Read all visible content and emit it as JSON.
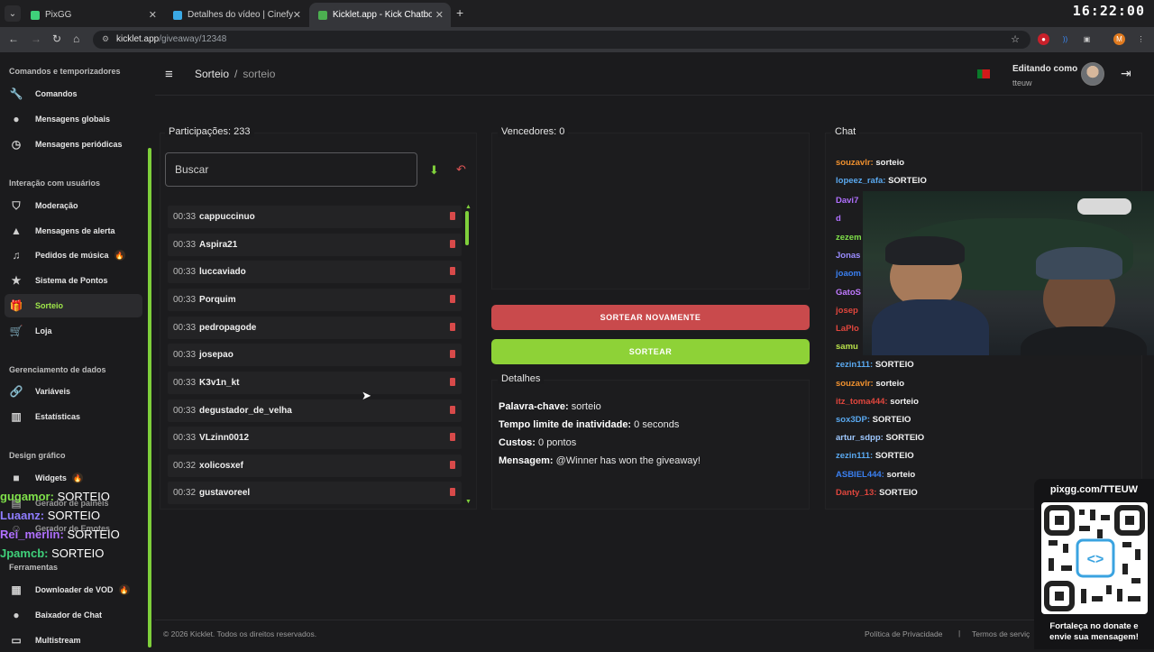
{
  "browser": {
    "clock": "16:22:00",
    "tabs": [
      {
        "label": "PixGG",
        "color": "#3fd17a"
      },
      {
        "label": "Detalhes do vídeo | Cinefy",
        "color": "#3aa9e6"
      },
      {
        "label": "Kicklet.app - Kick Chatbot and",
        "color": "#4caf50"
      }
    ],
    "url_host": "kicklet.app",
    "url_path": "/giveaway/12348"
  },
  "sidebar": {
    "sections": [
      {
        "title": "Comandos e temporizadores",
        "items": [
          "Comandos",
          "Mensagens globais",
          "Mensagens periódicas"
        ]
      },
      {
        "title": "Interação com usuários",
        "items": [
          "Moderação",
          "Mensagens de alerta",
          "Pedidos de música",
          "Sistema de Pontos",
          "Sorteio",
          "Loja"
        ]
      },
      {
        "title": "Gerenciamento de dados",
        "items": [
          "Variáveis",
          "Estatísticas"
        ]
      },
      {
        "title": "Design gráfico",
        "items": [
          "Widgets",
          "Gerador de painéis",
          "Gerador de Emotes"
        ]
      },
      {
        "title": "Ferramentas",
        "items": [
          "Downloader de VOD",
          "Baixador de Chat",
          "Multistream"
        ]
      }
    ]
  },
  "header": {
    "breadcrumb_root": "Sorteio",
    "breadcrumb_current": "sorteio",
    "editing_as": "Editando como",
    "username": "tteuw"
  },
  "participants": {
    "title": "Participações: 233",
    "search_placeholder": "Buscar",
    "entries": [
      {
        "time": "00:33",
        "name": "cappuccinuo"
      },
      {
        "time": "00:33",
        "name": "Aspira21"
      },
      {
        "time": "00:33",
        "name": "luccaviado"
      },
      {
        "time": "00:33",
        "name": "Porquim"
      },
      {
        "time": "00:33",
        "name": "pedropagode"
      },
      {
        "time": "00:33",
        "name": "josepao"
      },
      {
        "time": "00:33",
        "name": "K3v1n_kt"
      },
      {
        "time": "00:33",
        "name": "degustador_de_velha"
      },
      {
        "time": "00:33",
        "name": "VLzinn0012"
      },
      {
        "time": "00:32",
        "name": "xolicosxef"
      },
      {
        "time": "00:32",
        "name": "gustavoreel"
      }
    ]
  },
  "winners": {
    "title": "Vencedores: 0"
  },
  "buttons": {
    "redraw": "SORTEAR NOVAMENTE",
    "draw": "SORTEAR"
  },
  "details": {
    "title": "Detalhes",
    "keyword_label": "Palavra-chave:",
    "keyword_value": "sorteio",
    "inactivity_label": "Tempo limite de inatividade:",
    "inactivity_value": "0 seconds",
    "cost_label": "Custos:",
    "cost_value": "0 pontos",
    "message_label": "Mensagem:",
    "message_value": "@Winner has won the giveaway!"
  },
  "chat": {
    "title": "Chat",
    "lines": [
      {
        "user": "souzavlr:",
        "msg": "sorteio",
        "color": "#f0912f"
      },
      {
        "user": "lopeez_rafa:",
        "msg": "SORTEIO",
        "color": "#5aa9f0"
      },
      {
        "user": "Davi7",
        "msg": "",
        "color": "#b070ff"
      },
      {
        "user": "d",
        "msg": "",
        "color": "#b070ff"
      },
      {
        "user": "zezem",
        "msg": "",
        "color": "#7fe04a"
      },
      {
        "user": "Jonas",
        "msg": "",
        "color": "#9a8cff"
      },
      {
        "user": "joaom",
        "msg": "",
        "color": "#3a7ff0"
      },
      {
        "user": "GatoS",
        "msg": "",
        "color": "#c07aff"
      },
      {
        "user": "josep",
        "msg": "",
        "color": "#e0463d"
      },
      {
        "user": "LaPlo",
        "msg": "",
        "color": "#e0463d"
      },
      {
        "user": "samu",
        "msg": "",
        "color": "#b8e04a"
      },
      {
        "user": "zezin111:",
        "msg": "SORTEIO",
        "color": "#5aa9f0"
      },
      {
        "user": "souzavlr:",
        "msg": "sorteio",
        "color": "#f0912f"
      },
      {
        "user": "itz_toma444:",
        "msg": "sorteio",
        "color": "#e0463d"
      },
      {
        "user": "sox3DP:",
        "msg": "SORTEIO",
        "color": "#5aa9f0"
      },
      {
        "user": "artur_sdpp:",
        "msg": "SORTEIO",
        "color": "#9ec8ff"
      },
      {
        "user": "zezin111:",
        "msg": "SORTEIO",
        "color": "#5aa9f0"
      },
      {
        "user": "ASBIEL444:",
        "msg": "sorteio",
        "color": "#3a7ff0"
      },
      {
        "user": "Danty_13:",
        "msg": "SORTEIO",
        "color": "#e0463d"
      }
    ]
  },
  "overlay_chat": [
    {
      "user": "gugamor:",
      "msg": "SORTEIO",
      "color": "#7fe04a"
    },
    {
      "user": "Luaanz:",
      "msg": "SORTEIO",
      "color": "#8f7dff"
    },
    {
      "user": "Rei_merlin:",
      "msg": "SORTEIO",
      "color": "#b070ff"
    },
    {
      "user": "Jpamcb:",
      "msg": "SORTEIO",
      "color": "#3fd17a"
    }
  ],
  "donate": {
    "link": "pixgg.com/TTEUW",
    "caption": "Fortaleça no donate e envie sua mensagem!"
  },
  "footer": {
    "copyright": "© 2026 Kicklet. Todos os direitos reservados.",
    "privacy": "Política de Privacidade",
    "terms": "Termos de serviç"
  }
}
